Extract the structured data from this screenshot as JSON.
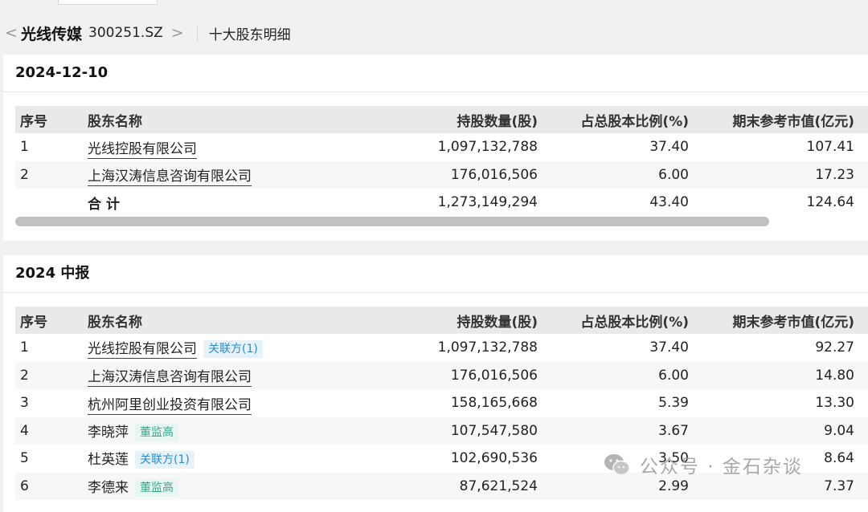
{
  "header": {
    "back_glyph": "<",
    "stock_name": "光线传媒",
    "stock_code": "300251.SZ",
    "forward_glyph": ">",
    "subtitle": "十大股东明细"
  },
  "columns": [
    "序号",
    "股东名称",
    "持股数量(股)",
    "占总股本比例(%)",
    "期末参考市值(亿元)"
  ],
  "section1": {
    "title": "2024-12-10",
    "rows": [
      {
        "no": "1",
        "name": "光线控股有限公司",
        "shares": "1,097,132,788",
        "ratio": "37.40",
        "value": "107.41"
      },
      {
        "no": "2",
        "name": "上海汉涛信息咨询有限公司",
        "shares": "176,016,506",
        "ratio": "6.00",
        "value": "17.23"
      }
    ],
    "total": {
      "label": "合计",
      "shares": "1,273,149,294",
      "ratio": "43.40",
      "value": "124.64"
    }
  },
  "section2": {
    "title": "2024 中报",
    "rows": [
      {
        "no": "1",
        "name": "光线控股有限公司",
        "tag": "关联方(1)",
        "shares": "1,097,132,788",
        "ratio": "37.40",
        "value": "92.27"
      },
      {
        "no": "2",
        "name": "上海汉涛信息咨询有限公司",
        "shares": "176,016,506",
        "ratio": "6.00",
        "value": "14.80"
      },
      {
        "no": "3",
        "name": "杭州阿里创业投资有限公司",
        "shares": "158,165,668",
        "ratio": "5.39",
        "value": "13.30"
      },
      {
        "no": "4",
        "name": "李晓萍",
        "tag": "董监高",
        "shares": "107,547,580",
        "ratio": "3.67",
        "value": "9.04"
      },
      {
        "no": "5",
        "name": "杜英莲",
        "tag": "关联方(1)",
        "shares": "102,690,536",
        "ratio": "3.50",
        "value": "8.64"
      },
      {
        "no": "6",
        "name": "李德来",
        "tag": "董监高",
        "shares": "87,621,524",
        "ratio": "2.99",
        "value": "7.37"
      }
    ]
  },
  "watermark": {
    "text": "公众号 · 金石杂谈",
    "icon": "wechat-icon"
  },
  "colors": {
    "tag_blue": "#2a8bd2",
    "tag_green": "#3aa58a",
    "header_bg": "#e9e9e9"
  }
}
